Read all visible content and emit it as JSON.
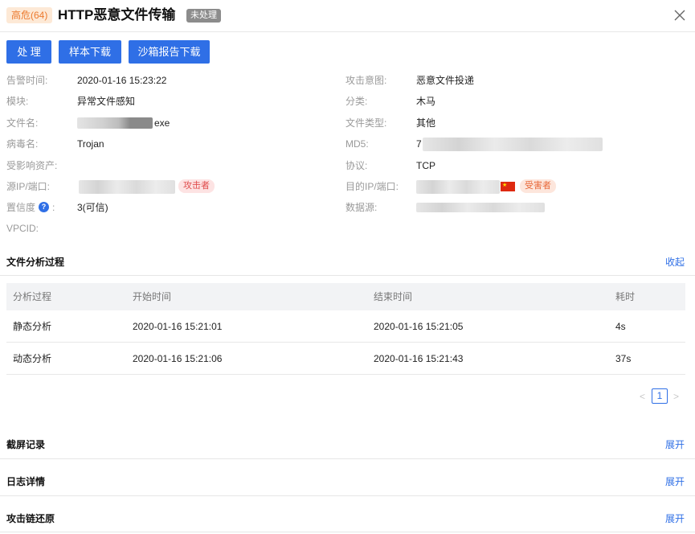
{
  "header": {
    "severity": "高危(64)",
    "title": "HTTP恶意文件传输",
    "status": "未处理"
  },
  "toolbar": {
    "handle_label": "处 理",
    "sample_download_label": "样本下载",
    "sandbox_report_label": "沙箱报告下载"
  },
  "details": {
    "alert_time": {
      "label": "告警时间:",
      "value": "2020-01-16 15:23:22"
    },
    "attack_intent": {
      "label": "攻击意图:",
      "value": "恶意文件投递"
    },
    "module": {
      "label": "模块:",
      "value": "异常文件感知"
    },
    "category": {
      "label": "分类:",
      "value": "木马"
    },
    "file_name": {
      "label": "文件名:",
      "value": "exe"
    },
    "file_type": {
      "label": "文件类型:",
      "value": "其他"
    },
    "virus_name": {
      "label": "病毒名:",
      "value": "Trojan"
    },
    "md5": {
      "label": "MD5:",
      "value": "7"
    },
    "affected_assets": {
      "label": "受影响资产:",
      "value": ""
    },
    "protocol": {
      "label": "协议:",
      "value": "TCP"
    },
    "src_ip": {
      "label": "源IP/端口:",
      "tag": "攻击者"
    },
    "dst_ip": {
      "label": "目的IP/端口:",
      "tag": "受害者"
    },
    "confidence": {
      "label": "置信度",
      "colon": ":",
      "value": "3(可信)"
    },
    "data_source": {
      "label": "数据源:",
      "value": ""
    },
    "vpcid": {
      "label": "VPCID:",
      "value": ""
    }
  },
  "analysis": {
    "title": "文件分析过程",
    "toggle": "收起",
    "columns": [
      "分析过程",
      "开始时间",
      "结束时间",
      "耗时"
    ],
    "rows": [
      {
        "process": "静态分析",
        "start": "2020-01-16 15:21:01",
        "end": "2020-01-16 15:21:05",
        "duration": "4s"
      },
      {
        "process": "动态分析",
        "start": "2020-01-16 15:21:06",
        "end": "2020-01-16 15:21:43",
        "duration": "37s"
      }
    ],
    "pagination": {
      "current_page": "1",
      "prev": "<",
      "next": ">"
    }
  },
  "sections": [
    {
      "title": "截屏记录",
      "toggle": "展开"
    },
    {
      "title": "日志详情",
      "toggle": "展开"
    },
    {
      "title": "攻击链还原",
      "toggle": "展开"
    }
  ],
  "colors": {
    "accent": "#2f6fe6",
    "severity_bg": "#fde9d6",
    "severity_text": "#ec7a2f",
    "status_bg": "#8c8c8c"
  },
  "icons": {
    "close": "close-icon",
    "help": "help-icon",
    "flag": "china-flag-icon"
  }
}
